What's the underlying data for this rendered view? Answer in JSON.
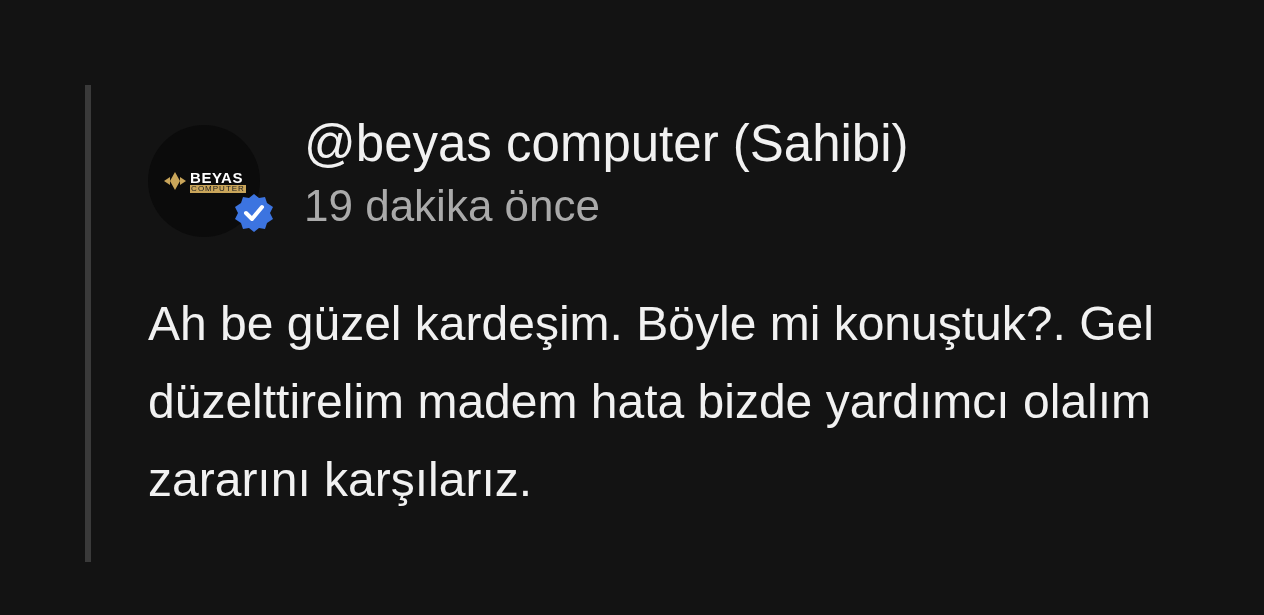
{
  "comment": {
    "avatar": {
      "logo_title": "BEYAS",
      "logo_subtitle": "COMPUTER",
      "verified": true
    },
    "author": "@beyas computer (Sahibi)",
    "time": "19 dakika önce",
    "text": "Ah be güzel kardeşim. Böyle mi konuştuk?. Gel düzelttirelim madem hata bizde yardımcı olalım zararını karşılarız."
  }
}
